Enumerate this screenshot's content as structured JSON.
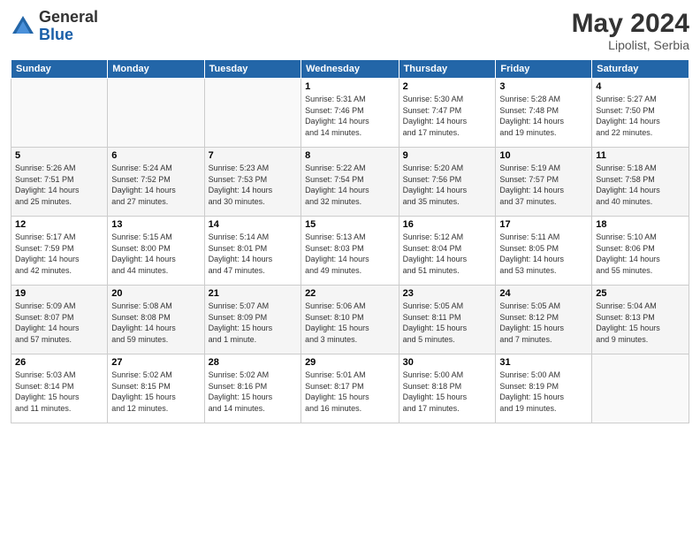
{
  "header": {
    "logo_general": "General",
    "logo_blue": "Blue",
    "month_year": "May 2024",
    "location": "Lipolist, Serbia"
  },
  "weekdays": [
    "Sunday",
    "Monday",
    "Tuesday",
    "Wednesday",
    "Thursday",
    "Friday",
    "Saturday"
  ],
  "weeks": [
    [
      {
        "day": "",
        "info": ""
      },
      {
        "day": "",
        "info": ""
      },
      {
        "day": "",
        "info": ""
      },
      {
        "day": "1",
        "info": "Sunrise: 5:31 AM\nSunset: 7:46 PM\nDaylight: 14 hours\nand 14 minutes."
      },
      {
        "day": "2",
        "info": "Sunrise: 5:30 AM\nSunset: 7:47 PM\nDaylight: 14 hours\nand 17 minutes."
      },
      {
        "day": "3",
        "info": "Sunrise: 5:28 AM\nSunset: 7:48 PM\nDaylight: 14 hours\nand 19 minutes."
      },
      {
        "day": "4",
        "info": "Sunrise: 5:27 AM\nSunset: 7:50 PM\nDaylight: 14 hours\nand 22 minutes."
      }
    ],
    [
      {
        "day": "5",
        "info": "Sunrise: 5:26 AM\nSunset: 7:51 PM\nDaylight: 14 hours\nand 25 minutes."
      },
      {
        "day": "6",
        "info": "Sunrise: 5:24 AM\nSunset: 7:52 PM\nDaylight: 14 hours\nand 27 minutes."
      },
      {
        "day": "7",
        "info": "Sunrise: 5:23 AM\nSunset: 7:53 PM\nDaylight: 14 hours\nand 30 minutes."
      },
      {
        "day": "8",
        "info": "Sunrise: 5:22 AM\nSunset: 7:54 PM\nDaylight: 14 hours\nand 32 minutes."
      },
      {
        "day": "9",
        "info": "Sunrise: 5:20 AM\nSunset: 7:56 PM\nDaylight: 14 hours\nand 35 minutes."
      },
      {
        "day": "10",
        "info": "Sunrise: 5:19 AM\nSunset: 7:57 PM\nDaylight: 14 hours\nand 37 minutes."
      },
      {
        "day": "11",
        "info": "Sunrise: 5:18 AM\nSunset: 7:58 PM\nDaylight: 14 hours\nand 40 minutes."
      }
    ],
    [
      {
        "day": "12",
        "info": "Sunrise: 5:17 AM\nSunset: 7:59 PM\nDaylight: 14 hours\nand 42 minutes."
      },
      {
        "day": "13",
        "info": "Sunrise: 5:15 AM\nSunset: 8:00 PM\nDaylight: 14 hours\nand 44 minutes."
      },
      {
        "day": "14",
        "info": "Sunrise: 5:14 AM\nSunset: 8:01 PM\nDaylight: 14 hours\nand 47 minutes."
      },
      {
        "day": "15",
        "info": "Sunrise: 5:13 AM\nSunset: 8:03 PM\nDaylight: 14 hours\nand 49 minutes."
      },
      {
        "day": "16",
        "info": "Sunrise: 5:12 AM\nSunset: 8:04 PM\nDaylight: 14 hours\nand 51 minutes."
      },
      {
        "day": "17",
        "info": "Sunrise: 5:11 AM\nSunset: 8:05 PM\nDaylight: 14 hours\nand 53 minutes."
      },
      {
        "day": "18",
        "info": "Sunrise: 5:10 AM\nSunset: 8:06 PM\nDaylight: 14 hours\nand 55 minutes."
      }
    ],
    [
      {
        "day": "19",
        "info": "Sunrise: 5:09 AM\nSunset: 8:07 PM\nDaylight: 14 hours\nand 57 minutes."
      },
      {
        "day": "20",
        "info": "Sunrise: 5:08 AM\nSunset: 8:08 PM\nDaylight: 14 hours\nand 59 minutes."
      },
      {
        "day": "21",
        "info": "Sunrise: 5:07 AM\nSunset: 8:09 PM\nDaylight: 15 hours\nand 1 minute."
      },
      {
        "day": "22",
        "info": "Sunrise: 5:06 AM\nSunset: 8:10 PM\nDaylight: 15 hours\nand 3 minutes."
      },
      {
        "day": "23",
        "info": "Sunrise: 5:05 AM\nSunset: 8:11 PM\nDaylight: 15 hours\nand 5 minutes."
      },
      {
        "day": "24",
        "info": "Sunrise: 5:05 AM\nSunset: 8:12 PM\nDaylight: 15 hours\nand 7 minutes."
      },
      {
        "day": "25",
        "info": "Sunrise: 5:04 AM\nSunset: 8:13 PM\nDaylight: 15 hours\nand 9 minutes."
      }
    ],
    [
      {
        "day": "26",
        "info": "Sunrise: 5:03 AM\nSunset: 8:14 PM\nDaylight: 15 hours\nand 11 minutes."
      },
      {
        "day": "27",
        "info": "Sunrise: 5:02 AM\nSunset: 8:15 PM\nDaylight: 15 hours\nand 12 minutes."
      },
      {
        "day": "28",
        "info": "Sunrise: 5:02 AM\nSunset: 8:16 PM\nDaylight: 15 hours\nand 14 minutes."
      },
      {
        "day": "29",
        "info": "Sunrise: 5:01 AM\nSunset: 8:17 PM\nDaylight: 15 hours\nand 16 minutes."
      },
      {
        "day": "30",
        "info": "Sunrise: 5:00 AM\nSunset: 8:18 PM\nDaylight: 15 hours\nand 17 minutes."
      },
      {
        "day": "31",
        "info": "Sunrise: 5:00 AM\nSunset: 8:19 PM\nDaylight: 15 hours\nand 19 minutes."
      },
      {
        "day": "",
        "info": ""
      }
    ]
  ]
}
